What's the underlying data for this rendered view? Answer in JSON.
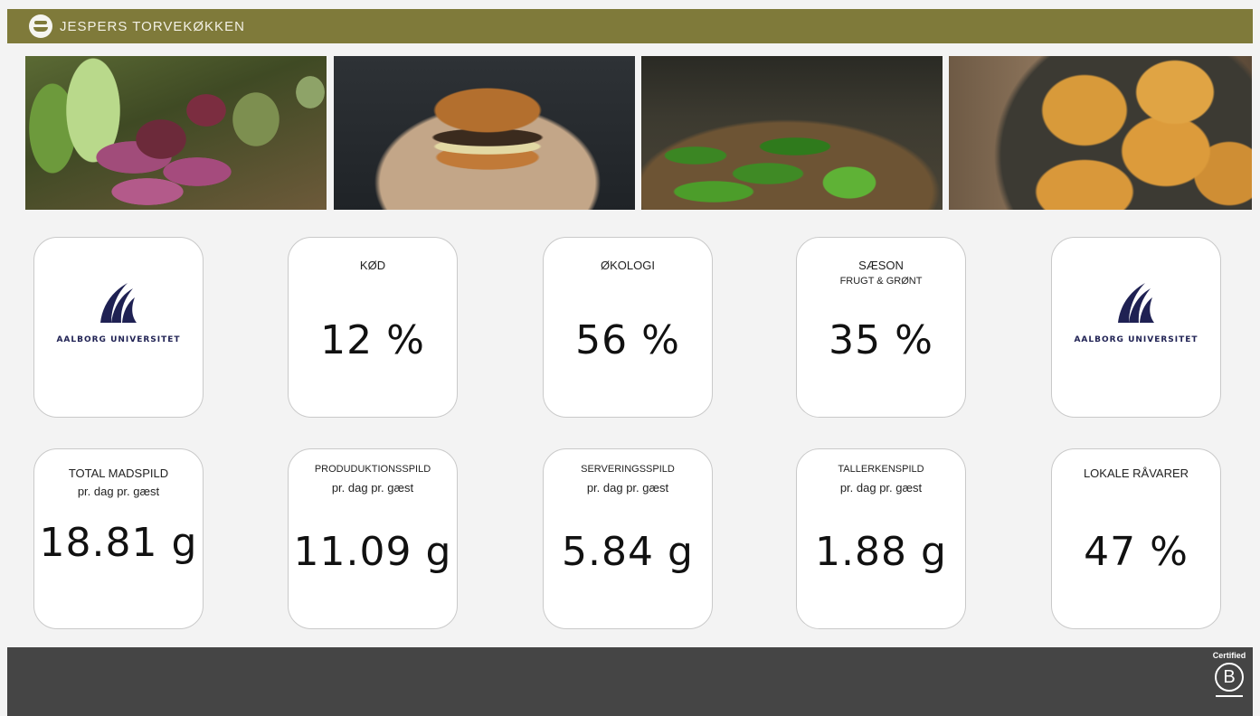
{
  "header": {
    "brand": "JESPERS TORVEKØKKEN"
  },
  "photos": [
    {
      "name": "vegetables-photo"
    },
    {
      "name": "burger-photo"
    },
    {
      "name": "green-peppers-photo"
    },
    {
      "name": "cornbread-photo"
    }
  ],
  "logo": {
    "text": "AALBORG UNIVERSITET"
  },
  "row1": {
    "meat": {
      "label": "KØD",
      "value": "12 %"
    },
    "organic": {
      "label": "ØKOLOGI",
      "value": "56 %"
    },
    "season": {
      "label": "SÆSON",
      "sublabel": "FRUGT & GRØNT",
      "value": "35 %"
    }
  },
  "row2": {
    "total": {
      "label": "TOTAL MADSPILD",
      "sublabel": "pr. dag pr. gæst",
      "value": "18.81 g"
    },
    "production": {
      "label": "PRODUDUKTIONSSPILD",
      "sublabel": "pr. dag pr. gæst",
      "value": "11.09 g"
    },
    "serving": {
      "label": "SERVERINGSSPILD",
      "sublabel": "pr. dag pr. gæst",
      "value": "5.84 g"
    },
    "plate": {
      "label": "TALLERKENSPILD",
      "sublabel": "pr. dag pr. gæst",
      "value": "1.88 g"
    },
    "local": {
      "label": "LOKALE RÅVARER",
      "value": "47 %"
    }
  },
  "footer": {
    "certified": "Certified",
    "bcorp_letter": "B"
  },
  "colors": {
    "header_bg": "#7f7a3a",
    "footer_bg": "#454545",
    "au_navy": "#1f2153"
  }
}
